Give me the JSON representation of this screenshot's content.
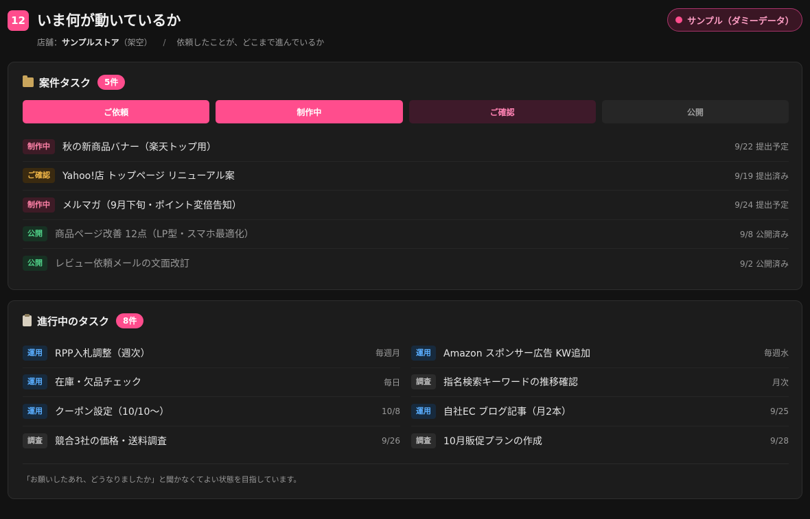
{
  "header": {
    "number": "12",
    "title": "いま何が動いているか",
    "store_label": "店舗：",
    "store_name": "サンプルストア",
    "store_note": "（架空）",
    "separator": "/",
    "description": "依頼したことが、どこまで進んでいるか",
    "sample_label": "サンプル（ダミーデータ）"
  },
  "project_tasks": {
    "title": "案件タスク",
    "count": "5件",
    "stages": [
      {
        "label": "ご依頼"
      },
      {
        "label": "制作中"
      },
      {
        "label": "ご確認"
      },
      {
        "label": "公開"
      }
    ],
    "items": [
      {
        "status": "制作中",
        "name": "秋の新商品バナー（楽天トップ用）",
        "meta": "9/22 提出予定"
      },
      {
        "status": "ご確認",
        "name": "Yahoo!店 トップページ リニューアル案",
        "meta": "9/19 提出済み"
      },
      {
        "status": "制作中",
        "name": "メルマガ（9月下旬・ポイント変倍告知）",
        "meta": "9/24 提出予定"
      },
      {
        "status": "公開",
        "name": "商品ページ改善 12点（LP型・スマホ最適化）",
        "meta": "9/8 公開済み"
      },
      {
        "status": "公開",
        "name": "レビュー依頼メールの文面改訂",
        "meta": "9/2 公開済み"
      }
    ]
  },
  "ongoing_tasks": {
    "title": "進行中のタスク",
    "count": "8件",
    "items": [
      {
        "status": "運用",
        "name": "RPP入札調整（週次）",
        "meta": "毎週月"
      },
      {
        "status": "運用",
        "name": "Amazon スポンサー広告 KW追加",
        "meta": "毎週水"
      },
      {
        "status": "運用",
        "name": "在庫・欠品チェック",
        "meta": "毎日"
      },
      {
        "status": "調査",
        "name": "指名検索キーワードの推移確認",
        "meta": "月次"
      },
      {
        "status": "運用",
        "name": "クーポン設定（10/10〜）",
        "meta": "10/8"
      },
      {
        "status": "運用",
        "name": "自社EC ブログ記事（月2本）",
        "meta": "9/25"
      },
      {
        "status": "調査",
        "name": "競合3社の価格・送料調査",
        "meta": "9/26"
      },
      {
        "status": "調査",
        "name": "10月販促プランの作成",
        "meta": "9/28"
      }
    ],
    "footer_note": "「お願いしたあれ、どうなりましたか」と聞かなくてよい状態を目指しています。"
  },
  "colors": {
    "accent": "#ff4d8d",
    "background": "#121212",
    "card": "#1c1c1c"
  }
}
